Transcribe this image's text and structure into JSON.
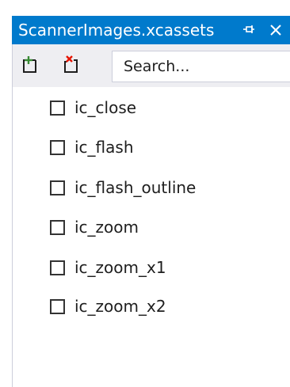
{
  "window": {
    "title": "ScannerImages.xcassets",
    "pin_icon": "pin-icon",
    "close_icon": "close-icon"
  },
  "toolbar": {
    "add_icon": "add-item-icon",
    "remove_icon": "remove-item-icon",
    "search_placeholder": "Search..."
  },
  "items": [
    {
      "label": "ic_close",
      "checked": false
    },
    {
      "label": "ic_flash",
      "checked": false
    },
    {
      "label": "ic_flash_outline",
      "checked": false
    },
    {
      "label": "ic_zoom",
      "checked": false
    },
    {
      "label": "ic_zoom_x1",
      "checked": false
    },
    {
      "label": "ic_zoom_x2",
      "checked": false
    }
  ],
  "colors": {
    "titlebar": "#007acc",
    "toolbar": "#eeeef2",
    "add_icon": "#388a34",
    "remove_icon": "#e51400"
  }
}
